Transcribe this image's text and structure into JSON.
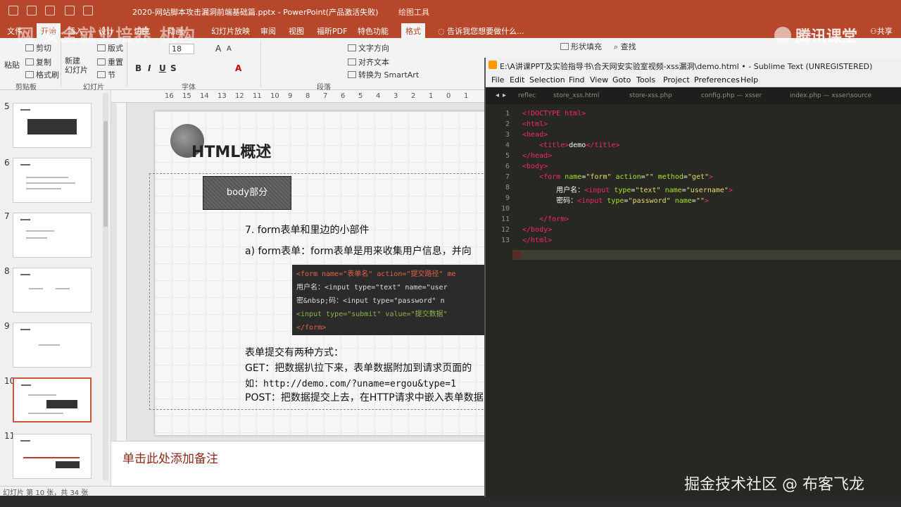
{
  "ppt": {
    "title": "2020-网站脚本攻击漏洞前端基础篇.pptx - PowerPoint(产品激活失败)",
    "drawing_tools": "绘图工具",
    "menu_tabs": [
      "文件",
      "开始",
      "插入",
      "设计",
      "切换",
      "动画",
      "幻灯片放映",
      "审阅",
      "视图",
      "福昕PDF",
      "特色功能",
      "格式"
    ],
    "tell_me": "告诉我您想要做什么...",
    "share": "共享",
    "ribbon": {
      "paste": "粘贴",
      "cut": "剪切",
      "copy": "复制",
      "format_painter": "格式刷",
      "new_slide": "新建\n幻灯片",
      "layout": "版式",
      "reset": "重置",
      "section": "节",
      "font_size": "18",
      "text_direction": "文字方向",
      "align_text": "对齐文本",
      "convert_smartart": "转换为 SmartArt",
      "shape_fill": "形状填充",
      "find": "查找",
      "groups": {
        "clipboard": "剪贴板",
        "slides": "幻灯片",
        "font": "字体",
        "paragraph": "段落"
      }
    },
    "watermark_left": "网 安全就业培养 机构",
    "watermark_logo": "腾讯课堂",
    "thumbnails": [
      {
        "num": "5"
      },
      {
        "num": "6"
      },
      {
        "num": "7"
      },
      {
        "num": "8"
      },
      {
        "num": "9"
      },
      {
        "num": "10"
      },
      {
        "num": "11"
      }
    ],
    "ruler_ticks": [
      "16",
      "15",
      "14",
      "13",
      "12",
      "11",
      "10",
      "9",
      "8",
      "7",
      "6",
      "5",
      "4",
      "3",
      "2",
      "1",
      "0",
      "1"
    ],
    "slide": {
      "title": "HTML概述",
      "body_label": "body部分",
      "item7": "7.  form表单和里边的小部件",
      "item_a": "a)  form表单：form表单是用来收集用户信息，并向",
      "code_lines": [
        "<form  name=\"表单名\" action=\"提交路径\" me",
        "    用户名：<input type=\"text\" name=\"user",
        "    密&nbsp;码：<input type=\"password\" n",
        "    <input type=\"submit\" value=\"提交数据\"",
        "</form>"
      ],
      "submit_methods": "表单提交有两种方式：",
      "get_line": "GET：把数据扒拉下来，表单数据附加到请求页面的",
      "example_line": "如：http://demo.com/?uname=ergou&type=1",
      "post_line": "POST：把数据提交上去，在HTTP请求中嵌入表单数据"
    },
    "notes_placeholder": "单击此处添加备注",
    "status": "幻灯片 第 10 张，共 34 张"
  },
  "sublime": {
    "title": "E:\\A讲课PPT及实验指导书\\合天网安实验室视频-xss漏洞\\demo.html • - Sublime Text (UNREGISTERED)",
    "menu": [
      "File",
      "Edit",
      "Selection",
      "Find",
      "View",
      "Goto",
      "Tools",
      "Project",
      "Preferences",
      "Help"
    ],
    "tabs": [
      "reflec",
      "store_xss.html",
      "store-xss.php",
      "config.php — xsser",
      "index.php — xsser\\source"
    ],
    "line_numbers": [
      "1",
      "2",
      "3",
      "4",
      "5",
      "6",
      "7",
      "8",
      "9",
      "10",
      "11",
      "12",
      "13"
    ]
  },
  "footer_watermark": "掘金技术社区 @ 布客飞龙"
}
